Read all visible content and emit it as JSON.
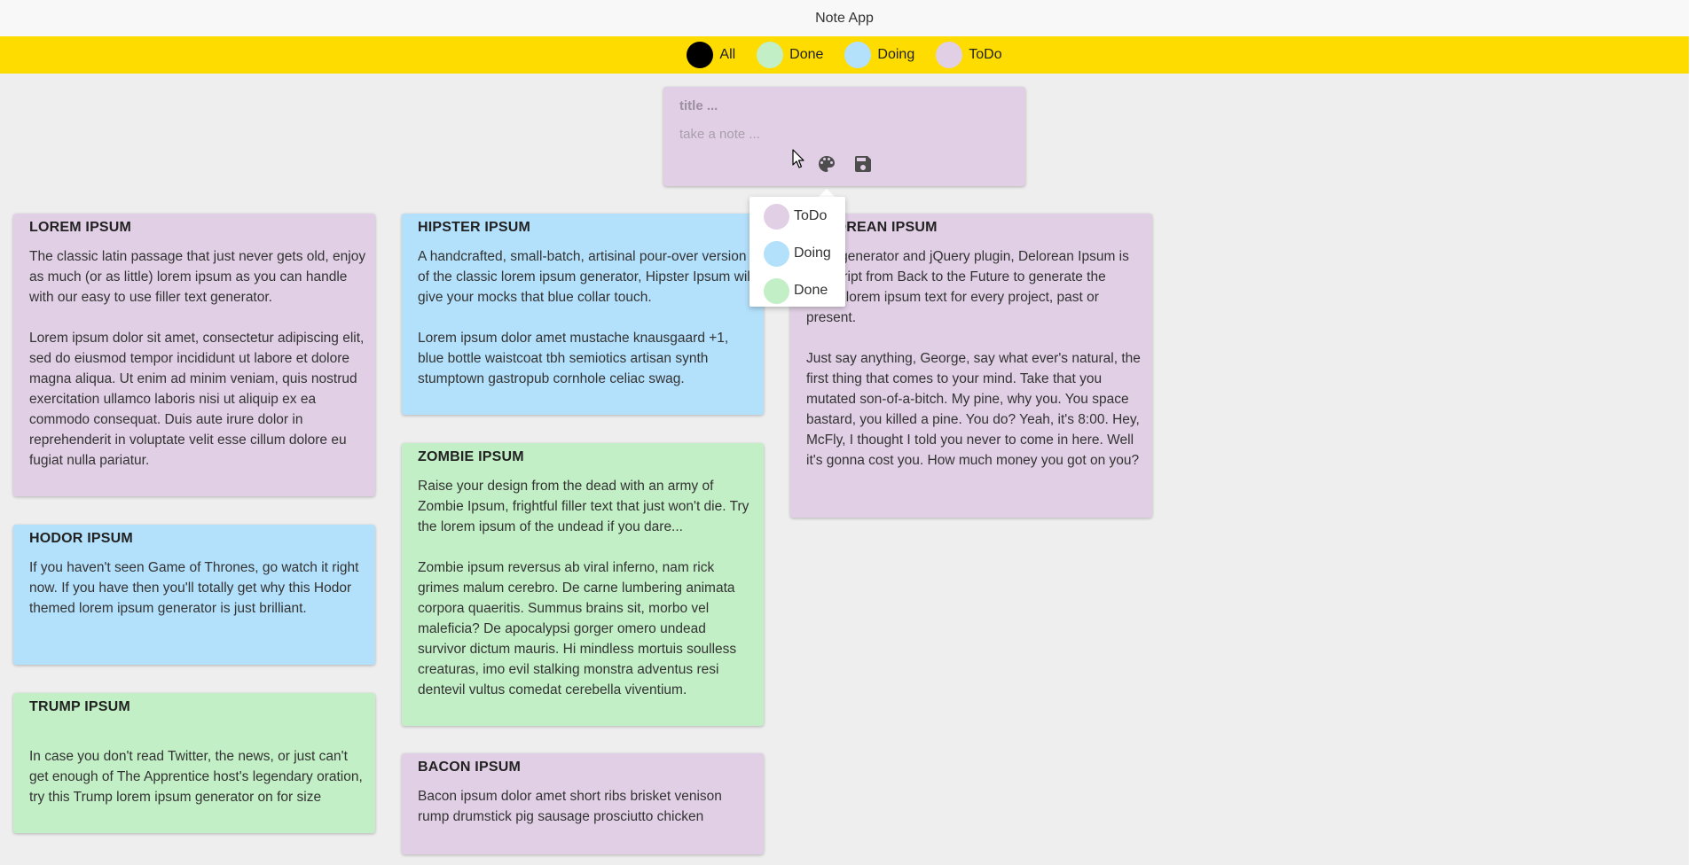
{
  "app": {
    "title": "Note App"
  },
  "filters": [
    {
      "label": "All",
      "color": "#000000"
    },
    {
      "label": "Done",
      "color": "#c2efc5"
    },
    {
      "label": "Doing",
      "color": "#b3e0fb"
    },
    {
      "label": "ToDo",
      "color": "#e1cfe5"
    }
  ],
  "composer": {
    "title_placeholder": "title ...",
    "note_placeholder": "take a note ...",
    "palette_icon": "palette-icon",
    "save_icon": "save-icon"
  },
  "color_menu": {
    "items": [
      {
        "label": "ToDo",
        "color": "#e1cfe5"
      },
      {
        "label": "Doing",
        "color": "#b3e0fb"
      },
      {
        "label": "Done",
        "color": "#c2efc5"
      }
    ]
  },
  "notes": [
    {
      "title": "LOREM IPSUM",
      "status": "ToDo",
      "body": "The classic latin passage that just never gets old, enjoy as much (or as little) lorem ipsum as you can handle with our easy to use filler text generator.\n\nLorem ipsum dolor sit amet, consectetur adipiscing elit, sed do eiusmod tempor incididunt ut labore et dolore magna aliqua. Ut enim ad minim veniam, quis nostrud exercitation ullamco laboris nisi ut aliquip ex ea commodo consequat. Duis aute irure dolor in reprehenderit in voluptate velit esse cillum dolore eu fugiat nulla pariatur."
    },
    {
      "title": "HODOR IPSUM",
      "status": "Doing",
      "body": "If you haven't seen Game of Thrones, go watch it right now. If you have then you'll totally get why this Hodor themed lorem ipsum generator is just brilliant."
    },
    {
      "title": "TRUMP IPSUM",
      "status": "Done",
      "body": "In case you don't read Twitter, the news, or just can't get enough of The Apprentice host's legendary oration, try this Trump lorem ipsum generator on for size"
    },
    {
      "title": "HIPSTER IPSUM",
      "status": "Doing",
      "body": "A handcrafted, small-batch, artisinal pour-over version of the classic lorem ipsum generator, Hipster Ipsum will give your mocks that blue collar touch.\n\nLorem ipsum dolor amet mustache knausgaard +1, blue bottle waistcoat tbh semiotics artisan synth stumptown gastropub cornhole celiac swag."
    },
    {
      "title": "ZOMBIE IPSUM",
      "status": "Done",
      "body": "Raise your design from the dead with an army of Zombie Ipsum, frightful filler text that just won't die. Try the lorem ipsum of the undead if you dare...\n\nZombie ipsum reversus ab viral inferno, nam rick grimes malum cerebro. De carne lumbering animata corpora quaeritis. Summus brains sit, morbo vel maleficia? De apocalypsi gorger omero undead survivor dictum mauris. Hi mindless mortuis soulless creaturas, imo evil stalking monstra adventus resi dentevil vultus comedat cerebella viventium."
    },
    {
      "title": "BACON IPSUM",
      "status": "ToDo",
      "body": "Bacon ipsum dolor amet short ribs brisket venison rump drumstick pig sausage prosciutto chicken"
    },
    {
      "title": "DELOREAN IPSUM",
      "status": "ToDo",
      "body": "Time generator and jQuery plugin, Delorean Ipsum is the script from Back to the Future to generate the whole lorem ipsum text for every project, past or present.\n\nJust say anything, George, say what ever's natural, the first thing that comes to your mind. Take that you mutated son-of-a-bitch. My pine, why you. You space bastard, you killed a pine. You do? Yeah, it's 8:00. Hey, McFly, I thought I told you never to come in here. Well it's gonna cost you. How much money you got on you?"
    }
  ]
}
